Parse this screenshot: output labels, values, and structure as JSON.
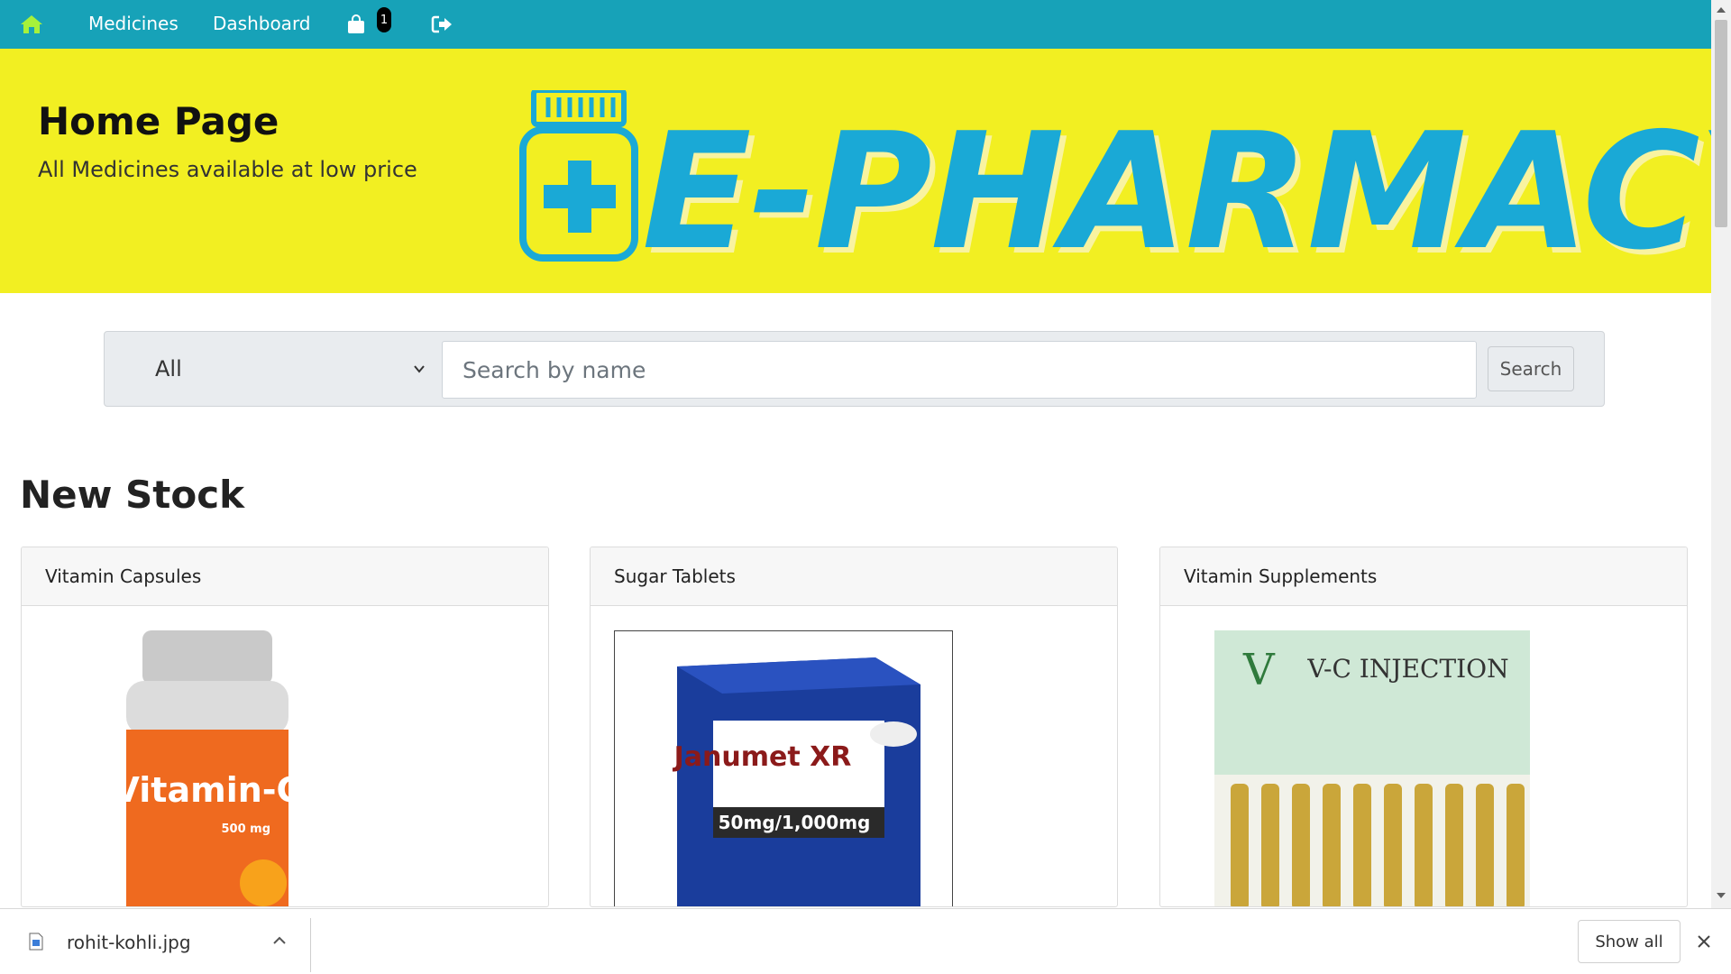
{
  "navbar": {
    "home_icon": "home-icon",
    "links": [
      "Medicines",
      "Dashboard"
    ],
    "cart_icon": "shopping-bag-icon",
    "cart_count": "1",
    "logout_icon": "logout-icon",
    "background": "#17a2b8",
    "home_icon_color": "#a6f13b"
  },
  "hero": {
    "title": "Home Page",
    "subtitle": "All Medicines available at low price",
    "brand": "E-PHARMACY",
    "background": "#f2ef22",
    "brand_color": "#1aa9d6"
  },
  "search": {
    "category_selected": "All",
    "placeholder": "Search by name",
    "button_label": "Search"
  },
  "new_stock": {
    "title": "New Stock",
    "cards": [
      {
        "title": "Vitamin Capsules",
        "image_text": "Vitamin-C",
        "image_subtext": "500 mg"
      },
      {
        "title": "Sugar Tablets",
        "image_text": "Janumet XR",
        "image_subtext": "50mg/1,000mg"
      },
      {
        "title": "Vitamin Supplements",
        "image_text": "V-C INJECTION",
        "image_subtext": ""
      }
    ]
  },
  "download_bar": {
    "filename": "rohit-kohli.jpg",
    "show_all_label": "Show all"
  }
}
